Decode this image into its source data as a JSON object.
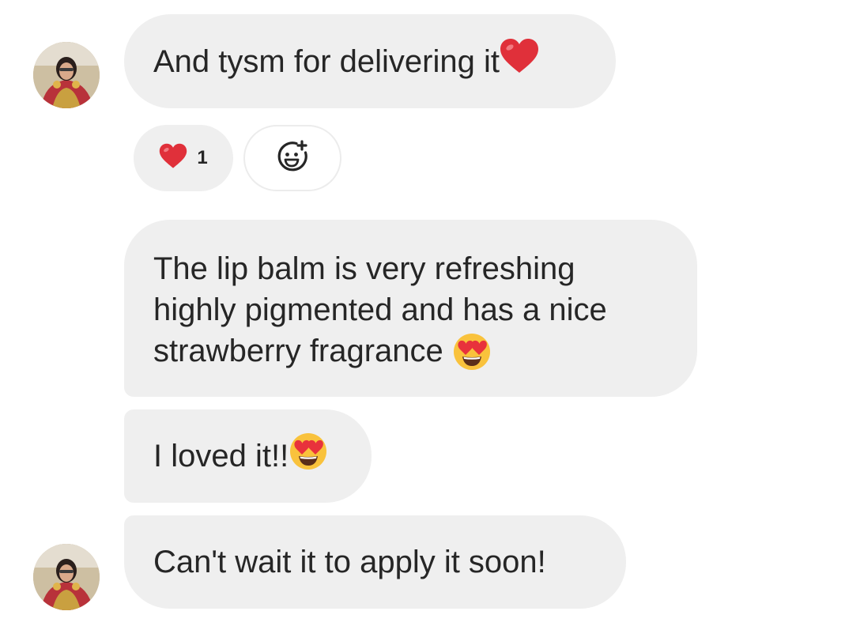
{
  "messages": [
    {
      "text": "And tysm for delivering it",
      "trailing_emoji": "red-heart"
    },
    {
      "lines": [
        "The lip balm is very refreshing",
        "highly pigmented and has a nice",
        "strawberry fragrance "
      ],
      "trailing_emoji": "heart-eyes"
    },
    {
      "text": "I loved it!!",
      "trailing_emoji": "heart-eyes"
    },
    {
      "text": "Can't wait it to apply it soon!"
    }
  ],
  "reactions": {
    "heart_count": "1",
    "heart_icon": "red-heart-icon",
    "add_icon": "add-reaction-icon"
  },
  "colors": {
    "bubble_bg": "#efefef",
    "text": "#262626",
    "heart": "#e0303a",
    "emoji_face": "#f9c23c"
  }
}
